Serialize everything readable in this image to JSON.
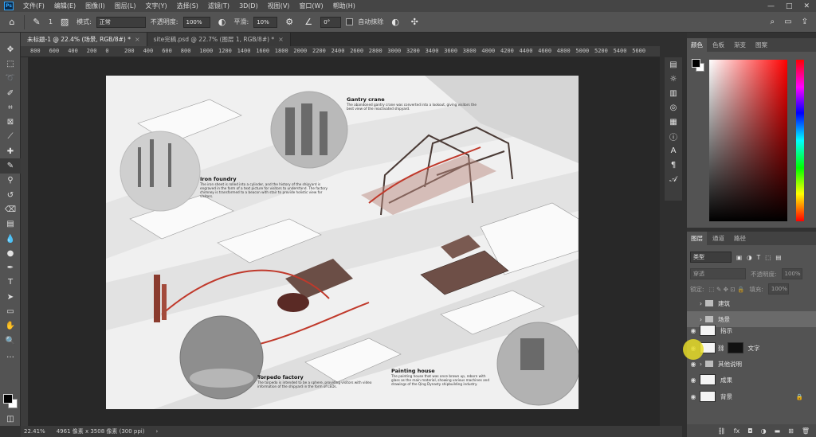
{
  "app": {
    "logo": "Ps"
  },
  "menu": [
    "文件(F)",
    "编辑(E)",
    "图像(I)",
    "图层(L)",
    "文字(Y)",
    "选择(S)",
    "滤镜(T)",
    "3D(D)",
    "视图(V)",
    "窗口(W)",
    "帮助(H)"
  ],
  "window_controls": [
    "—",
    "□",
    "✕"
  ],
  "options": {
    "brush_size": "1",
    "mode_label": "模式:",
    "mode_value": "正常",
    "opacity_label": "不透明度:",
    "opacity_value": "100%",
    "smoothing_label": "平滑:",
    "smoothing_value": "10%",
    "angle_value": "0°",
    "auto_erase_label": "自动抹除"
  },
  "tabs": [
    {
      "label": "未标题-1 @ 22.4% (场景, RGB/8#) *",
      "close": "×"
    },
    {
      "label": "site完稿.psd @ 22.7% (图层 1, RGB/8#) *",
      "close": "×"
    }
  ],
  "ruler_ticks": [
    "800",
    "600",
    "400",
    "200",
    "0",
    "200",
    "400",
    "600",
    "800",
    "1000",
    "1200",
    "1400",
    "1600",
    "1800",
    "2000",
    "2200",
    "2400",
    "2600",
    "2800",
    "3000",
    "3200",
    "3400",
    "3600",
    "3800",
    "4000",
    "4200",
    "4400",
    "4600",
    "4800",
    "5000",
    "5200",
    "5400",
    "5600"
  ],
  "status": {
    "zoom": "22.41%",
    "doc_size": "4961 像素 x 3508 像素 (300 ppi)"
  },
  "color_panel": {
    "tabs": [
      "颜色",
      "色板",
      "渐变",
      "图案"
    ]
  },
  "layers_panel": {
    "tabs": [
      "图层",
      "通道",
      "路径"
    ],
    "filter_kind": "类型",
    "blend_mode": "穿透",
    "opacity_label": "不透明度:",
    "opacity_value": "100%",
    "lock_label": "锁定:",
    "fill_label": "填充:",
    "fill_value": "100%",
    "layers": [
      {
        "name": "建筑",
        "kind": "folder",
        "visible": false
      },
      {
        "name": "场景",
        "kind": "folder",
        "visible": false,
        "selected": true
      },
      {
        "name": "指示",
        "kind": "layer",
        "visible": true
      },
      {
        "name": "文字",
        "kind": "layer-mask",
        "visible": true
      },
      {
        "name": "其他说明",
        "kind": "folder",
        "visible": true
      },
      {
        "name": "成果",
        "kind": "layer",
        "visible": true
      },
      {
        "name": "背景",
        "kind": "layer-locked",
        "visible": true
      }
    ]
  },
  "document": {
    "annotations": [
      {
        "title": "Gantry crane",
        "text": "The abandoned gantry crane was converted into a lookout, giving visitors the best view of the reactivated shipyard."
      },
      {
        "title": "Iron foundry",
        "text": "The iron sheet is rolled into a cylinder, and the history of the shipyard is engraved in the form of a text picture for visitors to understand. The factory chimney is transformed to a beacon with stair to provide holistic view for visitors."
      },
      {
        "title": "Torpedo factory",
        "text": "The torpedo is intended to be a sphere, providing visitors with video information of the shipyard in the form of LEDs."
      },
      {
        "title": "Painting house",
        "text": "The painting house that was once brown up, reborn with glass as the main material, showing various machines and drawings of the Qing Dynasty shipbuilding industry."
      }
    ]
  },
  "colors": {
    "accent_red": "#c0392b",
    "panel_bg": "#535353",
    "canvas_bg": "#282828"
  }
}
